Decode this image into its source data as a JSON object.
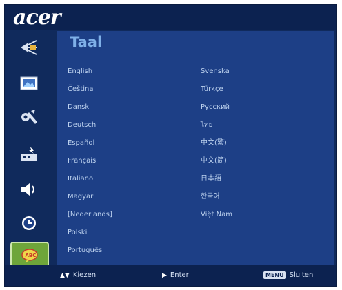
{
  "brand": {
    "logo": "acer"
  },
  "sidebar": {
    "items": [
      {
        "icon": "image-adjust-icon"
      },
      {
        "icon": "picture-icon"
      },
      {
        "icon": "settings-tools-icon"
      },
      {
        "icon": "management-icon"
      },
      {
        "icon": "speaker-icon"
      },
      {
        "icon": "timer-icon"
      },
      {
        "icon": "language-icon",
        "active": true
      }
    ]
  },
  "panel": {
    "title": "Taal",
    "languages_left": [
      "English",
      "Čeština",
      "Dansk",
      "Deutsch",
      "Español",
      "Français",
      "Italiano",
      "Magyar",
      "[Nederlands]",
      "Polski",
      "Português"
    ],
    "languages_right": [
      "Svenska",
      "Türkçe",
      "Русский",
      "ไทย",
      "中文(繁)",
      "中文(简)",
      "日本語",
      "한국어",
      "Việt Nam"
    ]
  },
  "footer": {
    "select_label": "Kiezen",
    "enter_label": "Enter",
    "menu_key": "MENU",
    "exit_label": "Sluiten"
  }
}
